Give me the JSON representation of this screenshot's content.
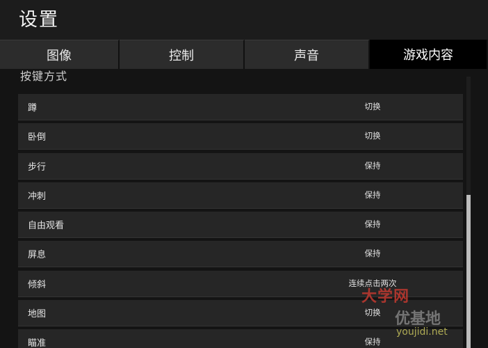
{
  "header": {
    "title": "设置"
  },
  "tabs": [
    {
      "label": "图像",
      "active": false
    },
    {
      "label": "控制",
      "active": false
    },
    {
      "label": "声音",
      "active": false
    },
    {
      "label": "游戏内容",
      "active": true
    }
  ],
  "section": {
    "label": "按键方式"
  },
  "rows": [
    {
      "label": "蹲",
      "value": "切换"
    },
    {
      "label": "卧倒",
      "value": "切换"
    },
    {
      "label": "步行",
      "value": "保持"
    },
    {
      "label": "冲刺",
      "value": "保持"
    },
    {
      "label": "自由观看",
      "value": "保持"
    },
    {
      "label": "屏息",
      "value": "保持"
    },
    {
      "label": "倾斜",
      "value": "连续点击两次"
    },
    {
      "label": "地图",
      "value": "切换"
    },
    {
      "label": "瞄准",
      "value": "保持"
    }
  ],
  "watermark": {
    "line1": "大学网",
    "line2": "优基地",
    "line3": "youjidi.net"
  }
}
